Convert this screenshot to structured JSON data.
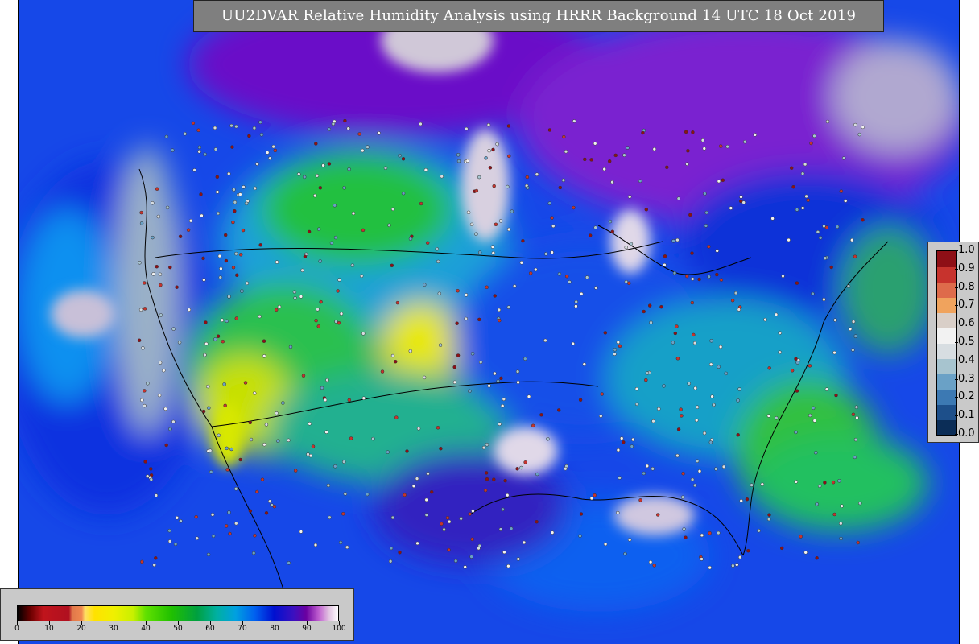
{
  "title": "UU2DVAR Relative Humidity Analysis using HRRR Background 14 UTC 18 Oct 2019",
  "observation_legend": {
    "ticks": [
      "1.0",
      "0.9",
      "0.8",
      "0.7",
      "0.6",
      "0.5",
      "0.4",
      "0.3",
      "0.2",
      "0.1",
      "0.0"
    ],
    "colors": [
      "#0b2d57",
      "#1d4f8a",
      "#3c79b3",
      "#6aa1c6",
      "#a7c4cf",
      "#d7dde1",
      "#f2f2f2",
      "#d9cfc8",
      "#f0a35d",
      "#de6b4b",
      "#c7332d",
      "#8e0f16"
    ]
  },
  "humidity_colorbar": {
    "ticks": [
      "0",
      "10",
      "20",
      "30",
      "40",
      "50",
      "60",
      "70",
      "80",
      "90",
      "100"
    ],
    "stops": [
      {
        "pct": 0,
        "color": "#000000"
      },
      {
        "pct": 4,
        "color": "#6b0000"
      },
      {
        "pct": 8,
        "color": "#c0141c"
      },
      {
        "pct": 16,
        "color": "#b01020"
      },
      {
        "pct": 17,
        "color": "#e0784a"
      },
      {
        "pct": 20,
        "color": "#f08850"
      },
      {
        "pct": 21,
        "color": "#ffe066"
      },
      {
        "pct": 24,
        "color": "#ffe200"
      },
      {
        "pct": 30,
        "color": "#f0f000"
      },
      {
        "pct": 36,
        "color": "#c8f000"
      },
      {
        "pct": 40,
        "color": "#60e000"
      },
      {
        "pct": 48,
        "color": "#20c000"
      },
      {
        "pct": 56,
        "color": "#00a040"
      },
      {
        "pct": 62,
        "color": "#00b0a0"
      },
      {
        "pct": 68,
        "color": "#00a0e0"
      },
      {
        "pct": 74,
        "color": "#0060f0"
      },
      {
        "pct": 80,
        "color": "#0010d0"
      },
      {
        "pct": 86,
        "color": "#3a10c0"
      },
      {
        "pct": 90,
        "color": "#6a00a0"
      },
      {
        "pct": 94,
        "color": "#c060d0"
      },
      {
        "pct": 97,
        "color": "#e0c0e0"
      },
      {
        "pct": 100,
        "color": "#ffffff"
      }
    ]
  }
}
